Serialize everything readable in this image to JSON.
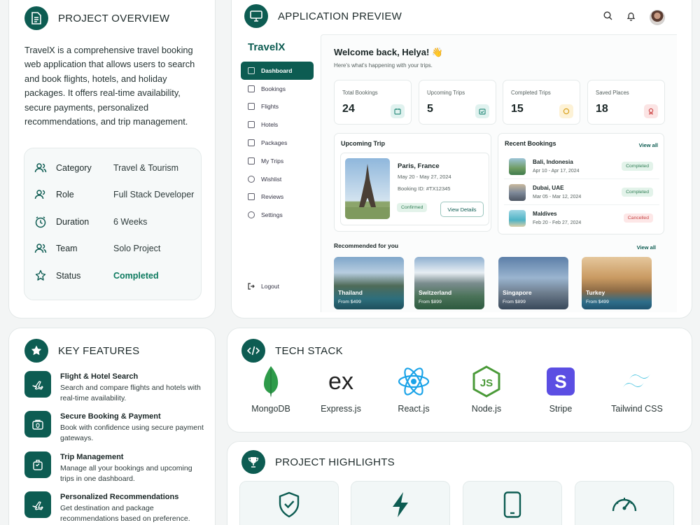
{
  "overview": {
    "title": "PROJECT OVERVIEW",
    "description": "TravelX is a comprehensive travel booking web application that allows users to search and book flights, hotels, and holiday packages. It offers real-time availability, secure payments, personalized recommendations, and trip management.",
    "info": [
      {
        "label": "Category",
        "value": "Travel & Tourism",
        "icon": "users-icon"
      },
      {
        "label": "Role",
        "value": "Full Stack Developer",
        "icon": "user-icon"
      },
      {
        "label": "Duration",
        "value": "6 Weeks",
        "icon": "clock-icon"
      },
      {
        "label": "Team",
        "value": "Solo Project",
        "icon": "team-icon"
      },
      {
        "label": "Status",
        "value": "Completed",
        "icon": "status-icon"
      }
    ]
  },
  "preview": {
    "title": "APPLICATION PREVIEW",
    "app": {
      "brand": "TravelX",
      "nav": [
        "Dashboard",
        "Bookings",
        "Flights",
        "Hotels",
        "Packages",
        "My Trips",
        "Wishlist",
        "Reviews",
        "Settings"
      ],
      "logout": "Logout",
      "welcome": "Welcome back, Helya! 👋",
      "welcome_sub": "Here's what's happening with your trips.",
      "stats": [
        {
          "label": "Total Bookings",
          "value": "24",
          "color": "#2f8f7f",
          "bg": "#e0f2ef"
        },
        {
          "label": "Upcoming Trips",
          "value": "5",
          "color": "#2f8f7f",
          "bg": "#e0f2ef"
        },
        {
          "label": "Completed Trips",
          "value": "15",
          "color": "#d9a21f",
          "bg": "#fdf2d6"
        },
        {
          "label": "Saved Places",
          "value": "18",
          "color": "#d04f4f",
          "bg": "#fbe4e4"
        }
      ],
      "upcoming": {
        "title": "Upcoming Trip",
        "city": "Paris, France",
        "dates": "May 20 - May 27, 2024",
        "booking_id": "Booking ID: #TX12345",
        "status": "Confirmed",
        "button": "View Details"
      },
      "recent": {
        "title": "Recent Bookings",
        "view_all": "View all",
        "items": [
          {
            "name": "Bali, Indonesia",
            "dates": "Apr 10 - Apr 17, 2024",
            "status": "Completed"
          },
          {
            "name": "Dubai, UAE",
            "dates": "Mar 05 - Mar 12, 2024",
            "status": "Completed"
          },
          {
            "name": "Maldives",
            "dates": "Feb 20 - Feb 27, 2024",
            "status": "Cancelled"
          }
        ]
      },
      "recommended": {
        "title": "Recommended for you",
        "view_all": "View all",
        "items": [
          {
            "name": "Thailand",
            "price": "From $499"
          },
          {
            "name": "Switzerland",
            "price": "From $899"
          },
          {
            "name": "Singapore",
            "price": "From $899"
          },
          {
            "name": "Turkey",
            "price": "From $499"
          }
        ]
      }
    }
  },
  "features": {
    "title": "KEY FEATURES",
    "items": [
      {
        "title": "Flight & Hotel Search",
        "desc": "Search and compare flights and hotels with real-time availability."
      },
      {
        "title": "Secure Booking & Payment",
        "desc": "Book with confidence using secure payment gateways."
      },
      {
        "title": "Trip Management",
        "desc": "Manage all your bookings and upcoming trips in one dashboard."
      },
      {
        "title": "Personalized Recommendations",
        "desc": "Get destination and package recommendations based on preference."
      }
    ]
  },
  "tech": {
    "title": "TECH STACK",
    "items": [
      "MongoDB",
      "Express.js",
      "React.js",
      "Node.js",
      "Stripe",
      "Tailwind CSS"
    ],
    "express_glyph": "ex",
    "stripe_glyph": "S"
  },
  "highlights": {
    "title": "PROJECT HIGHLIGHTS",
    "icons": [
      "shield-check-icon",
      "lightning-icon",
      "mobile-icon",
      "speedometer-icon"
    ]
  },
  "colors": {
    "brand": "#0d5c52",
    "completed": "#0d7a5f",
    "cancelled": "#c74545"
  }
}
